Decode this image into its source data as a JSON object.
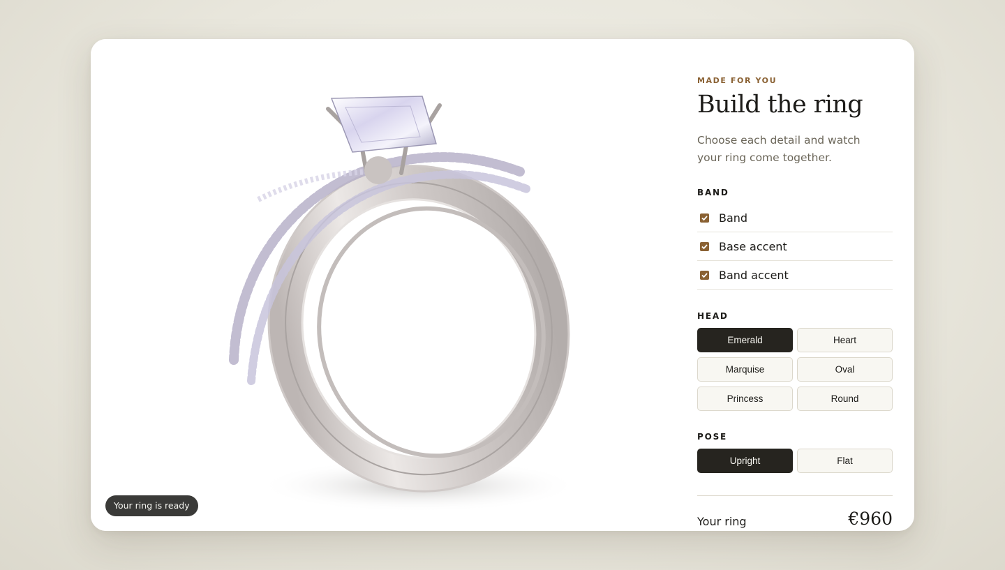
{
  "preview": {
    "status_pill": "Your ring is ready"
  },
  "panel": {
    "eyebrow": "MADE FOR YOU",
    "title": "Build the ring",
    "subtitle": "Choose each detail and watch your ring come together."
  },
  "band": {
    "label": "BAND",
    "options": [
      {
        "label": "Band",
        "checked": true
      },
      {
        "label": "Base accent",
        "checked": true
      },
      {
        "label": "Band accent",
        "checked": true
      }
    ]
  },
  "head": {
    "label": "HEAD",
    "selected": "Emerald",
    "options": [
      "Emerald",
      "Heart",
      "Marquise",
      "Oval",
      "Princess",
      "Round"
    ]
  },
  "pose": {
    "label": "POSE",
    "selected": "Upright",
    "options": [
      "Upright",
      "Flat"
    ]
  },
  "summary": {
    "label": "Your ring",
    "price": "€960"
  },
  "colors": {
    "accent": "#8a6133",
    "selected_button": "#26241f",
    "button_bg": "#f8f7f2",
    "metal": "#d9d4d2"
  }
}
